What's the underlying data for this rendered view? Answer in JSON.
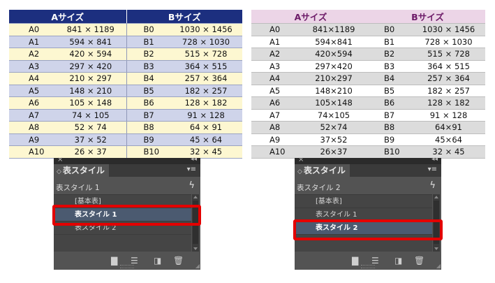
{
  "left_table": {
    "header_a": "Aサイズ",
    "header_b": "Bサイズ",
    "rows": [
      {
        "a": "A0",
        "av": "841 × 1189",
        "b": "B0",
        "bv": "1030 × 1456"
      },
      {
        "a": "A1",
        "av": "594 × 841",
        "b": "B1",
        "bv": "728 × 1030"
      },
      {
        "a": "A2",
        "av": "420 × 594",
        "b": "B2",
        "bv": "515 × 728"
      },
      {
        "a": "A3",
        "av": "297 × 420",
        "b": "B3",
        "bv": "364 × 515"
      },
      {
        "a": "A4",
        "av": "210 × 297",
        "b": "B4",
        "bv": "257 × 364"
      },
      {
        "a": "A5",
        "av": "148 × 210",
        "b": "B5",
        "bv": "182 × 257"
      },
      {
        "a": "A6",
        "av": "105 × 148",
        "b": "B6",
        "bv": "128 × 182"
      },
      {
        "a": "A7",
        "av": "74 × 105",
        "b": "B7",
        "bv": "91 × 128"
      },
      {
        "a": "A8",
        "av": "52 × 74",
        "b": "B8",
        "bv": "64 × 91"
      },
      {
        "a": "A9",
        "av": "37 × 52",
        "b": "B9",
        "bv": "45 × 64"
      },
      {
        "a": "A10",
        "av": "26 × 37",
        "b": "B10",
        "bv": "32 × 45"
      }
    ]
  },
  "right_table": {
    "header_a": "Aサイズ",
    "header_b": "Bサイズ",
    "rows": [
      {
        "a": "A0",
        "av": "841×1189",
        "b": "B0",
        "bv": "1030 × 1456"
      },
      {
        "a": "A1",
        "av": "594×841",
        "b": "B1",
        "bv": "728 × 1030"
      },
      {
        "a": "A2",
        "av": "420×594",
        "b": "B2",
        "bv": "515 × 728"
      },
      {
        "a": "A3",
        "av": "297×420",
        "b": "B3",
        "bv": "364 × 515"
      },
      {
        "a": "A4",
        "av": "210×297",
        "b": "B4",
        "bv": "257 × 364"
      },
      {
        "a": "A5",
        "av": "148×210",
        "b": "B5",
        "bv": "182 × 257"
      },
      {
        "a": "A6",
        "av": "105×148",
        "b": "B6",
        "bv": "128 × 182"
      },
      {
        "a": "A7",
        "av": "74×105",
        "b": "B7",
        "bv": "91 × 128"
      },
      {
        "a": "A8",
        "av": "52×74",
        "b": "B8",
        "bv": "64×91"
      },
      {
        "a": "A9",
        "av": "37×52",
        "b": "B9",
        "bv": "45×64"
      },
      {
        "a": "A10",
        "av": "26×37",
        "b": "B10",
        "bv": "32 × 45"
      }
    ]
  },
  "panel_left": {
    "close_glyph": "×",
    "collapse_glyph": "◂◂",
    "tab_arrows": "◇",
    "tab_title": "表スタイル",
    "menu_glyph": "▾≡",
    "current_style": "表スタイル 1",
    "bolt_glyph": "ϟ",
    "items": [
      "[基本表]",
      "表スタイル 1",
      "表スタイル 2"
    ],
    "selected_index": 1,
    "icons": {
      "folder": "▇",
      "load": "☰",
      "new": "◨",
      "trash": "🗑"
    }
  },
  "panel_right": {
    "close_glyph": "×",
    "collapse_glyph": "◂◂",
    "tab_arrows": "◇",
    "tab_title": "表スタイル",
    "menu_glyph": "▾≡",
    "current_style": "表スタイル 2",
    "bolt_glyph": "ϟ",
    "items": [
      "[基本表]",
      "表スタイル 1",
      "表スタイル 2"
    ],
    "selected_index": 2,
    "icons": {
      "folder": "▇",
      "load": "☰",
      "new": "◨",
      "trash": "🗑"
    }
  },
  "colors": {
    "left_header": "#1c2f7f",
    "left_row_odd": "#fdf7d1",
    "left_row_even": "#cfd4ea",
    "right_header_bg": "#ecd5e7",
    "right_header_text": "#6d1b68",
    "right_row_odd": "#dcdcdc",
    "highlight": "#e30000",
    "panel_bg": "#535353",
    "selected_item": "#4b5a70"
  }
}
